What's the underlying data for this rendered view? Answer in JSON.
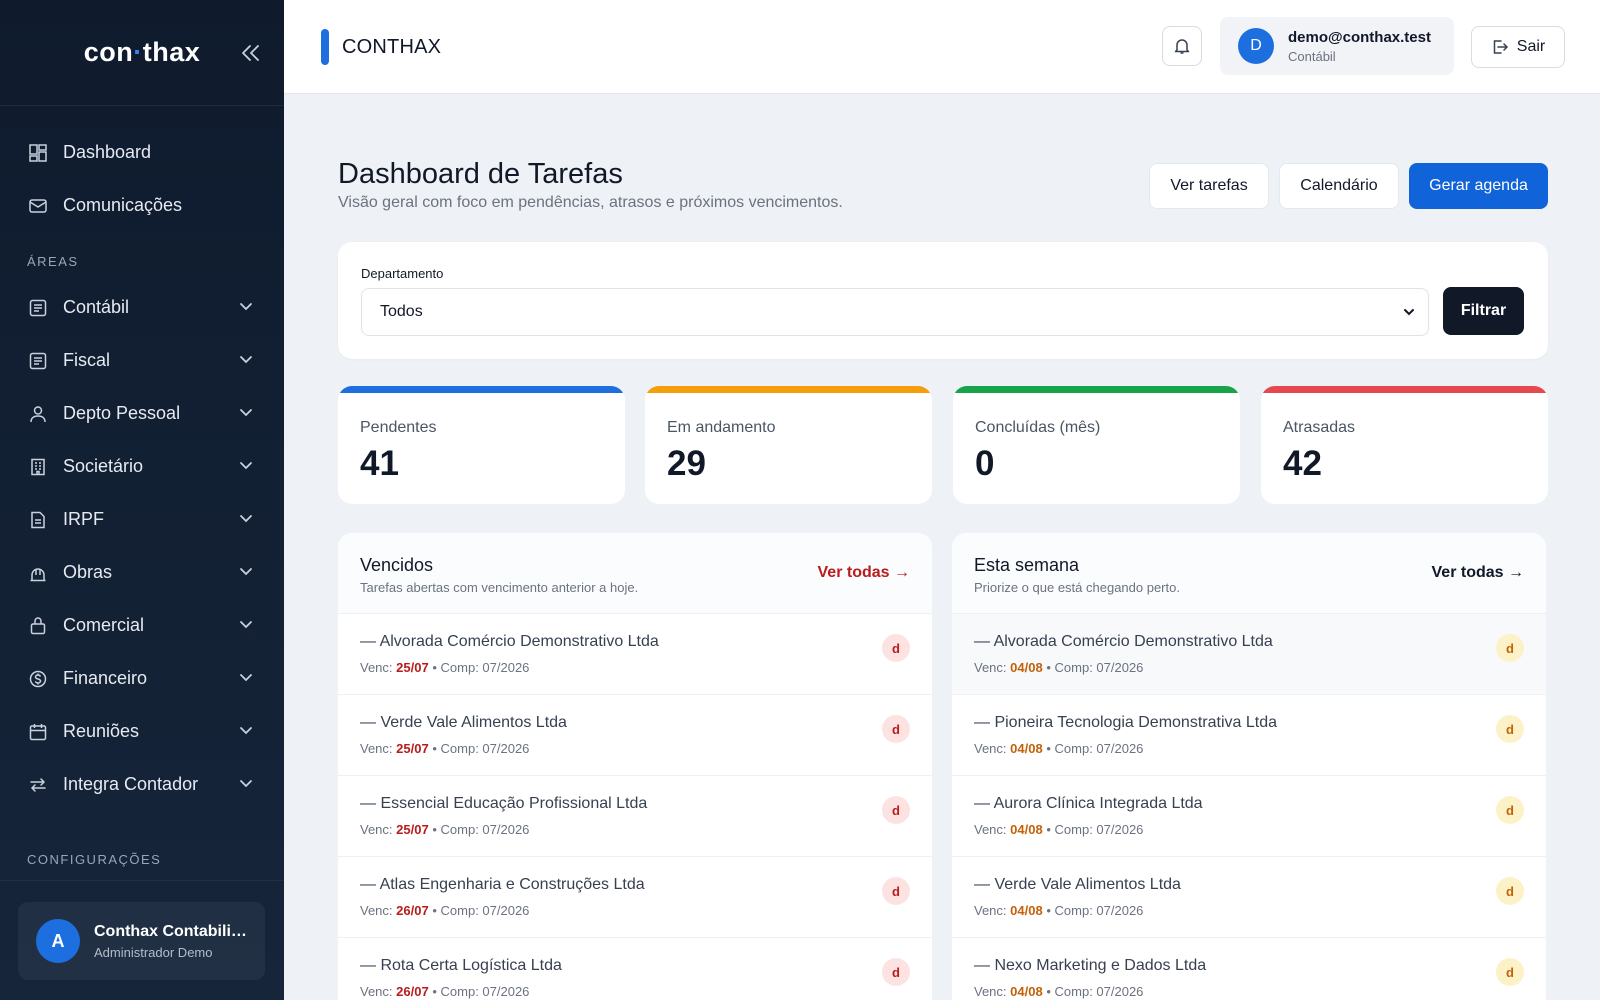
{
  "sidebar": {
    "logo_left": "con",
    "logo_dot": "·",
    "logo_right": "thax",
    "top_items": [
      {
        "label": "Dashboard",
        "icon": "dashboard-icon"
      },
      {
        "label": "Comunicações",
        "icon": "mail-icon"
      }
    ],
    "areas_label": "ÁREAS",
    "area_items": [
      {
        "label": "Contábil",
        "icon": "ledger-icon"
      },
      {
        "label": "Fiscal",
        "icon": "ledger-icon"
      },
      {
        "label": "Depto Pessoal",
        "icon": "user-icon"
      },
      {
        "label": "Societário",
        "icon": "building-icon"
      },
      {
        "label": "IRPF",
        "icon": "document-icon"
      },
      {
        "label": "Obras",
        "icon": "construction-icon"
      },
      {
        "label": "Comercial",
        "icon": "briefcase-icon"
      },
      {
        "label": "Financeiro",
        "icon": "dollar-icon"
      },
      {
        "label": "Reuniões",
        "icon": "calendar-icon"
      },
      {
        "label": "Integra Contador",
        "icon": "swap-icon"
      }
    ],
    "config_label": "CONFIGURAÇÕES",
    "user": {
      "initial": "A",
      "name": "Conthax Contabilidade",
      "role": "Administrador Demo"
    }
  },
  "topbar": {
    "brand": "CONTHAX",
    "account": {
      "initial": "D",
      "email": "demo@conthax.test",
      "role": "Contábil"
    },
    "logout_label": "Sair"
  },
  "header": {
    "title": "Dashboard de Tarefas",
    "subtitle": "Visão geral com foco em pendências, atrasos e próximos vencimentos.",
    "btn_tasks": "Ver tarefas",
    "btn_calendar": "Calendário",
    "btn_agenda": "Gerar agenda"
  },
  "filter": {
    "label": "Departamento",
    "selected": "Todos",
    "button": "Filtrar"
  },
  "stats": [
    {
      "label": "Pendentes",
      "value": "41",
      "color": "#1d6fe0"
    },
    {
      "label": "Em andamento",
      "value": "29",
      "color": "#f59e0b"
    },
    {
      "label": "Concluídas (mês)",
      "value": "0",
      "color": "#16a34a"
    },
    {
      "label": "Atrasadas",
      "value": "42",
      "color": "#e5484d"
    }
  ],
  "overdue": {
    "title": "Vencidos",
    "subtitle": "Tarefas abertas com vencimento anterior a hoje.",
    "link": "Ver todas →",
    "accent": "#b91c1c",
    "rows": [
      {
        "name": "— Alvorada Comércio Demonstrativo Ltda",
        "venc_label": "Venc:",
        "venc": "25/07",
        "sep": "•",
        "comp": "Comp: 07/2026",
        "badge": "d"
      },
      {
        "name": "— Verde Vale Alimentos Ltda",
        "venc_label": "Venc:",
        "venc": "25/07",
        "sep": "•",
        "comp": "Comp: 07/2026",
        "badge": "d"
      },
      {
        "name": "— Essencial Educação Profissional Ltda",
        "venc_label": "Venc:",
        "venc": "25/07",
        "sep": "•",
        "comp": "Comp: 07/2026",
        "badge": "d"
      },
      {
        "name": "— Atlas Engenharia e Construções Ltda",
        "venc_label": "Venc:",
        "venc": "26/07",
        "sep": "•",
        "comp": "Comp: 07/2026",
        "badge": "d"
      },
      {
        "name": "— Rota Certa Logística Ltda",
        "venc_label": "Venc:",
        "venc": "26/07",
        "sep": "•",
        "comp": "Comp: 07/2026",
        "badge": "d"
      }
    ]
  },
  "week": {
    "title": "Esta semana",
    "subtitle": "Priorize o que está chegando perto.",
    "link": "Ver todas →",
    "accent": "#c2620a",
    "rows": [
      {
        "name": "— Alvorada Comércio Demonstrativo Ltda",
        "venc_label": "Venc:",
        "venc": "04/08",
        "sep": "•",
        "comp": "Comp: 07/2026",
        "badge": "d"
      },
      {
        "name": "— Pioneira Tecnologia Demonstrativa Ltda",
        "venc_label": "Venc:",
        "venc": "04/08",
        "sep": "•",
        "comp": "Comp: 07/2026",
        "badge": "d"
      },
      {
        "name": "— Aurora Clínica Integrada Ltda",
        "venc_label": "Venc:",
        "venc": "04/08",
        "sep": "•",
        "comp": "Comp: 07/2026",
        "badge": "d"
      },
      {
        "name": "— Verde Vale Alimentos Ltda",
        "venc_label": "Venc:",
        "venc": "04/08",
        "sep": "•",
        "comp": "Comp: 07/2026",
        "badge": "d"
      },
      {
        "name": "— Nexo Marketing e Dados Ltda",
        "venc_label": "Venc:",
        "venc": "04/08",
        "sep": "•",
        "comp": "Comp: 07/2026",
        "badge": "d"
      }
    ]
  }
}
